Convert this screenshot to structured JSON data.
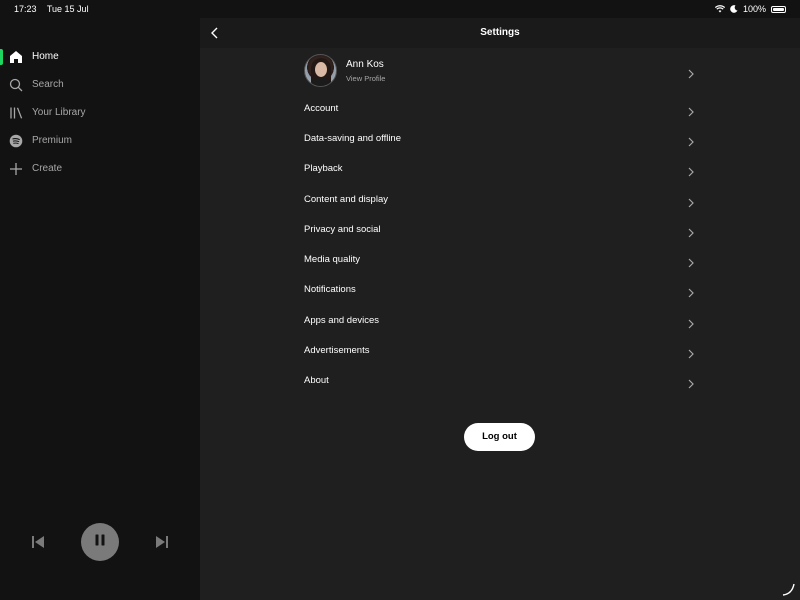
{
  "status_bar": {
    "time": "17:23",
    "date": "Tue 15 Jul",
    "battery": "100%"
  },
  "sidebar": {
    "items": [
      {
        "label": "Home",
        "icon": "home-icon",
        "active": true
      },
      {
        "label": "Search",
        "icon": "search-icon",
        "active": false
      },
      {
        "label": "Your Library",
        "icon": "library-icon",
        "active": false
      },
      {
        "label": "Premium",
        "icon": "spotify-icon",
        "active": false
      },
      {
        "label": "Create",
        "icon": "plus-icon",
        "active": false
      }
    ]
  },
  "player": {
    "state": "playing"
  },
  "header": {
    "title": "Settings"
  },
  "profile": {
    "name": "Ann Kos",
    "subtitle": "View Profile"
  },
  "settings": {
    "items": [
      "Account",
      "Data-saving and offline",
      "Playback",
      "Content and display",
      "Privacy and social",
      "Media quality",
      "Notifications",
      "Apps and devices",
      "Advertisements",
      "About"
    ]
  },
  "logout": {
    "label": "Log out"
  },
  "colors": {
    "accent": "#1ed760",
    "background": "#121212",
    "panel": "#1f1f1f",
    "text_secondary": "#a7a7a7"
  }
}
